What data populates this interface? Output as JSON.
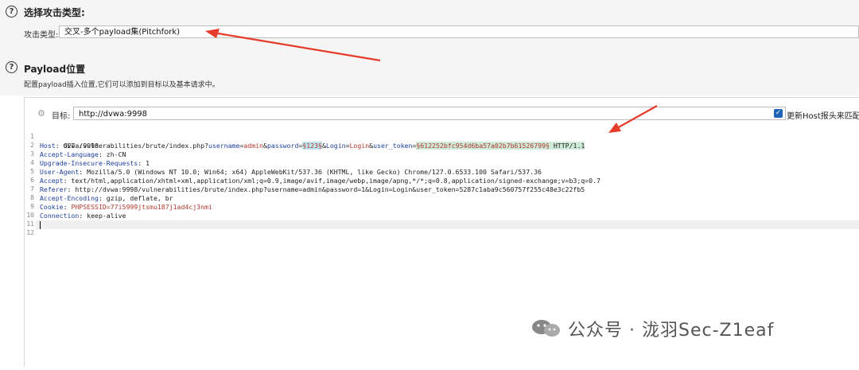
{
  "attack_type_section": {
    "title": "选择攻击类型:",
    "label": "攻击类型:",
    "selected": "交叉-多个payload集(Pitchfork)"
  },
  "payload_section": {
    "title": "Payload位置",
    "description": "配置payload插入位置,它们可以添加到目标以及基本请求中。"
  },
  "target": {
    "label": "目标:",
    "value": "http://dvwa:9998",
    "update_host_label": "更新Host报头来匹配目"
  },
  "request": {
    "line_numbers": [
      "1",
      "2",
      "3",
      "4",
      "5",
      "6",
      "7",
      "8",
      "9",
      "10",
      "11",
      "12"
    ],
    "line1": {
      "pre": "GET /vulnerabilities/brute/index.php?",
      "k1": "username",
      "eq1": "=",
      "v1": "admin",
      "amp1": "&",
      "k2": "password",
      "eq2": "=",
      "v2": "§123§",
      "amp2": "&",
      "k3": "Login",
      "eq3": "=",
      "v3": "Login",
      "amp3": "&",
      "k4": "user_token",
      "eq4": "=",
      "v4": "§612252bfc954d6ba57a02b7b61526799§",
      "post": " HTTP/1.1"
    },
    "headers": [
      {
        "key": "Host",
        "value": ": dvwa:9998"
      },
      {
        "key": "Accept-Language",
        "value": ": zh-CN"
      },
      {
        "key": "Upgrade-Insecure-Requests",
        "value": ": 1"
      },
      {
        "key": "User-Agent",
        "value": ": Mozilla/5.0 (Windows NT 10.0; Win64; x64) AppleWebKit/537.36 (KHTML, like Gecko) Chrome/127.0.6533.100 Safari/537.36"
      },
      {
        "key": "Accept",
        "value": ": text/html,application/xhtml+xml,application/xml;q=0.9,image/avif,image/webp,image/apng,*/*;q=0.8,application/signed-exchange;v=b3;q=0.7"
      },
      {
        "key": "Referer",
        "value": ": http://dvwa:9998/vulnerabilities/brute/index.php?username=admin&password=1&Login=Login&user_token=5287c1aba9c560757f255c48e3c22fb5"
      },
      {
        "key": "Accept-Encoding",
        "value": ": gzip, deflate, br"
      },
      {
        "key": "Cookie",
        "value": ": ",
        "cookie_value": "PHPSESSID=77i5999jtsmu187j1ad4cj3nmi"
      },
      {
        "key": "Connection",
        "value": ": keep-alive"
      }
    ]
  },
  "watermark": "公众号 · 泷羽Sec-Z1eaf",
  "colors": {
    "arrow": "#e53c2b",
    "checkbox": "#1e63b5",
    "payload_marker_bg": "#bfe6ef"
  }
}
